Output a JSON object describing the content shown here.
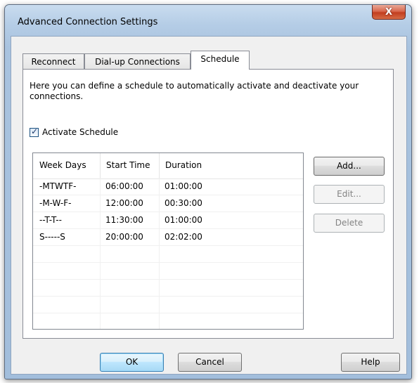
{
  "window": {
    "title": "Advanced Connection Settings",
    "close_glyph": "X"
  },
  "tabs": [
    {
      "label": "Reconnect",
      "active": false
    },
    {
      "label": "Dial-up Connections",
      "active": false
    },
    {
      "label": "Schedule",
      "active": true
    }
  ],
  "schedule": {
    "description": "Here you can define a schedule to automatically activate and deactivate your connections.",
    "activate_label": "Activate Schedule",
    "activate_checked": true,
    "columns": [
      "Week Days",
      "Start Time",
      "Duration"
    ],
    "rows": [
      [
        "-MTWTF-",
        "06:00:00",
        "01:00:00"
      ],
      [
        "-M-W-F-",
        "12:00:00",
        "00:30:00"
      ],
      [
        "--T-T--",
        "11:30:00",
        "01:00:00"
      ],
      [
        "S-----S",
        "20:00:00",
        "02:02:00"
      ]
    ],
    "add_label": "Add...",
    "edit_label": "Edit...",
    "delete_label": "Delete"
  },
  "footer": {
    "ok_label": "OK",
    "cancel_label": "Cancel",
    "help_label": "Help"
  },
  "colors": {
    "frame": "#a9c3df",
    "close": "#c23d1f",
    "default_button": "#bee6fd"
  }
}
